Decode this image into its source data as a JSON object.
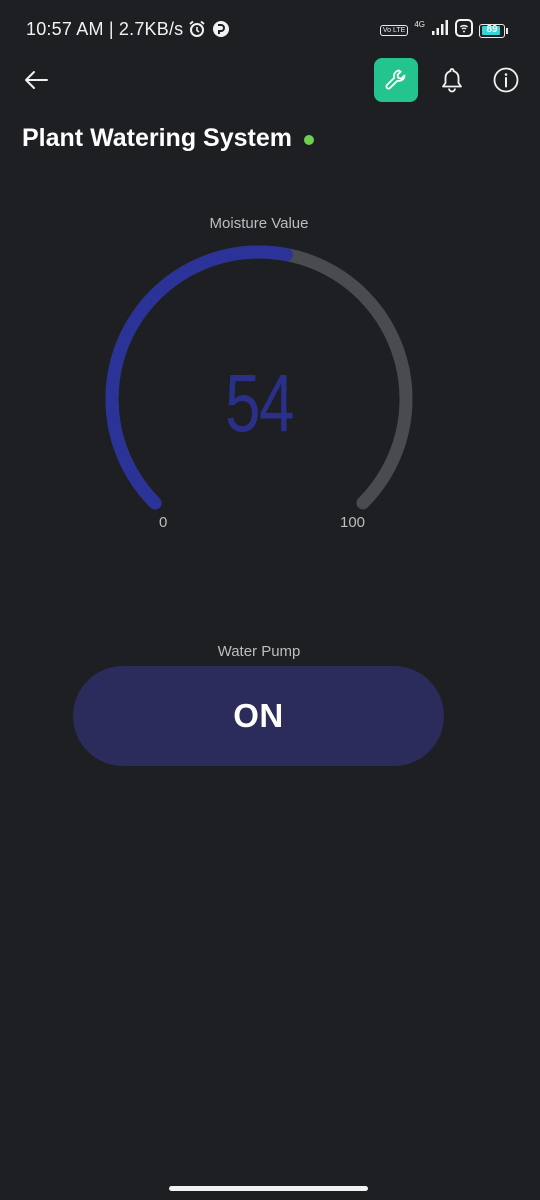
{
  "status_bar": {
    "time_speed": "10:57 AM | 2.7KB/s",
    "volte": "Vo LTE",
    "network": "4G",
    "battery": "89",
    "battery_level": 0.89
  },
  "header": {
    "title": "Plant Watering System",
    "online_color": "#6fcf53",
    "accent": "#23c48e"
  },
  "gauge": {
    "label": "Moisture Value",
    "value": 54,
    "value_text": "54",
    "min": 0,
    "max": 100,
    "min_label": "0",
    "max_label": "100",
    "fill_color": "#2b3399",
    "track_color": "#4a4b4f"
  },
  "pump": {
    "label": "Water Pump",
    "state_label": "ON",
    "color": "#2b2c5c"
  }
}
